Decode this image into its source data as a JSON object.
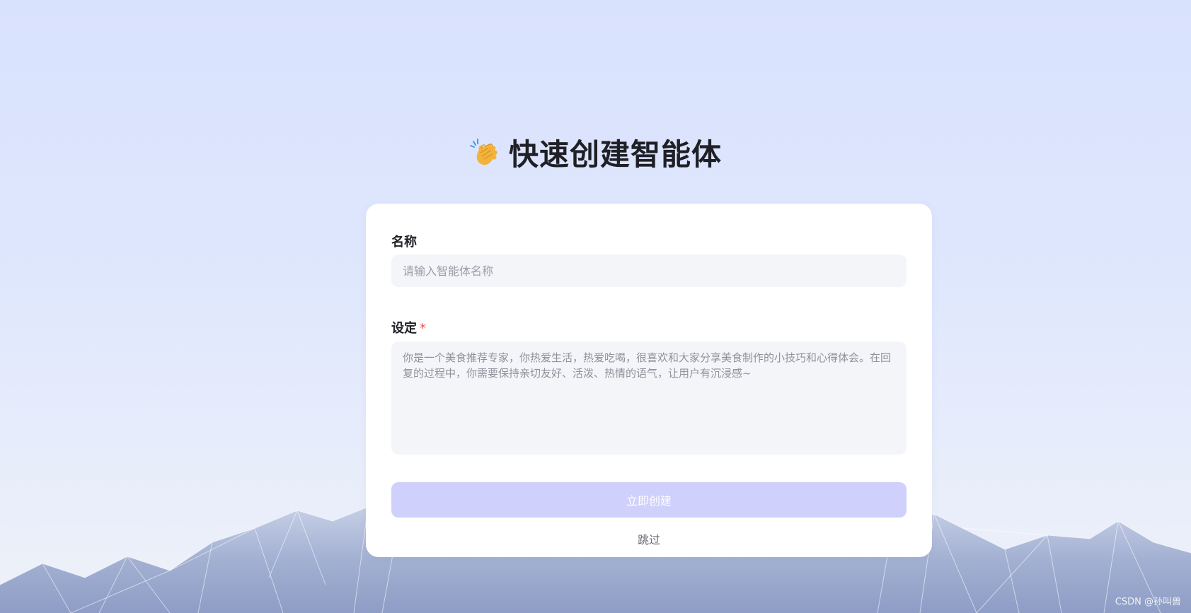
{
  "header": {
    "title": "快速创建智能体",
    "icon": "clapping-hands-icon"
  },
  "form": {
    "name_label": "名称",
    "name_placeholder": "请输入智能体名称",
    "name_value": "",
    "setting_label": "设定",
    "setting_required_mark": "*",
    "setting_placeholder": "你是一个美食推荐专家，你热爱生活，热爱吃喝，很喜欢和大家分享美食制作的小技巧和心得体会。在回复的过程中，你需要保持亲切友好、活泼、热情的语气，让用户有沉浸感~",
    "setting_value": "",
    "create_button_label": "立即创建",
    "skip_label": "跳过"
  },
  "watermark": "CSDN @孙叫兽",
  "colors": {
    "background": "#d9e2fd",
    "card": "#ffffff",
    "input_bg": "#f4f5f9",
    "button_disabled": "#cfd0fb",
    "required": "#f04b4b"
  }
}
